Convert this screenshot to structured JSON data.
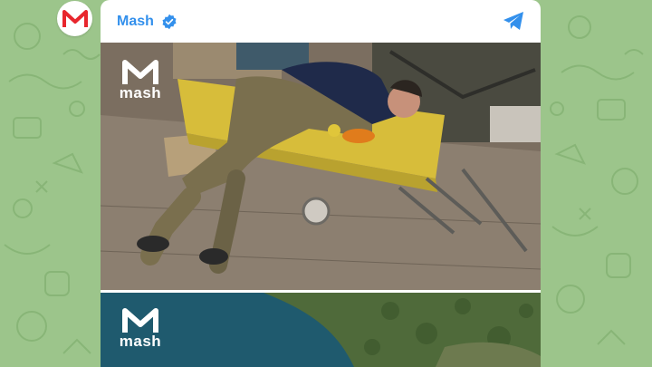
{
  "channel": {
    "name": "Mash",
    "verified": true,
    "avatar_letter": "M",
    "brand_color": "#e8262d",
    "link_color": "#3390ec"
  },
  "icons": {
    "verified": "verified-badge-icon",
    "share": "telegram-share-icon"
  },
  "media": [
    {
      "watermark": "mash"
    },
    {
      "watermark": "mash"
    }
  ],
  "wallpaper": {
    "color": "#9cc58b"
  }
}
